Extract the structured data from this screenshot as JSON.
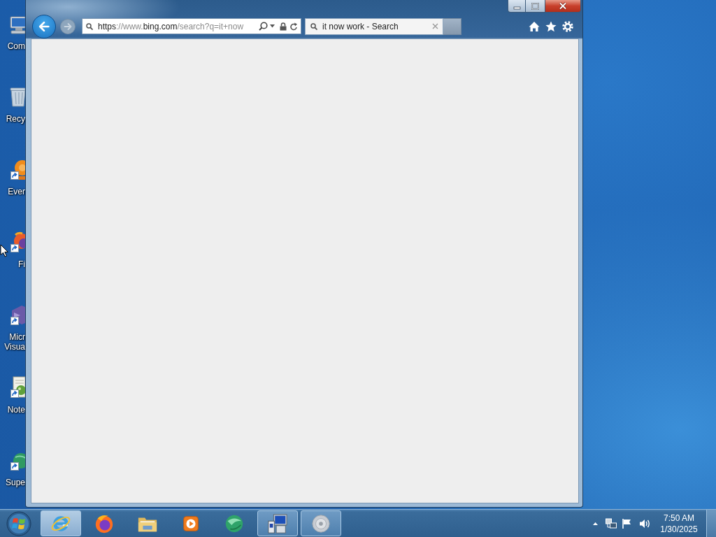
{
  "desktop_icons": [
    {
      "kind": "computer",
      "shortcut": false,
      "label": [
        "Com"
      ]
    },
    {
      "kind": "bin",
      "shortcut": false,
      "label": [
        "Recy"
      ]
    },
    {
      "kind": "blob",
      "shortcut": true,
      "label": [
        "Ever"
      ]
    },
    {
      "kind": "fox",
      "shortcut": true,
      "label": [
        "Fi"
      ]
    },
    {
      "kind": "wave",
      "shortcut": true,
      "label": [
        "Micr",
        "Visua"
      ]
    },
    {
      "kind": "notepad",
      "shortcut": true,
      "label": [
        "Note"
      ]
    },
    {
      "kind": "globe",
      "shortcut": true,
      "label": [
        "Supe"
      ]
    }
  ],
  "browser": {
    "back": {
      "disabled": false
    },
    "forward": {
      "disabled": true
    },
    "address": {
      "value": "**https**://www.**bing.com**/search?q=it+now"
    },
    "tabs": [
      {
        "label": "it now work - Search",
        "selected": true
      }
    ]
  },
  "taskbar": {
    "buttons": [
      {
        "kind": "ie",
        "running": true,
        "selected": true
      },
      {
        "kind": "fox",
        "running": false,
        "selected": false
      },
      {
        "kind": "folder",
        "running": false,
        "selected": false
      },
      {
        "kind": "media",
        "running": false,
        "selected": false
      },
      {
        "kind": "globe",
        "running": false,
        "selected": false
      },
      {
        "kind": "computer",
        "running": true,
        "selected": false
      },
      {
        "kind": "disc",
        "running": true,
        "selected": false
      }
    ],
    "clock": {
      "time": "7:50 AM",
      "date": "1/30/2025"
    }
  }
}
